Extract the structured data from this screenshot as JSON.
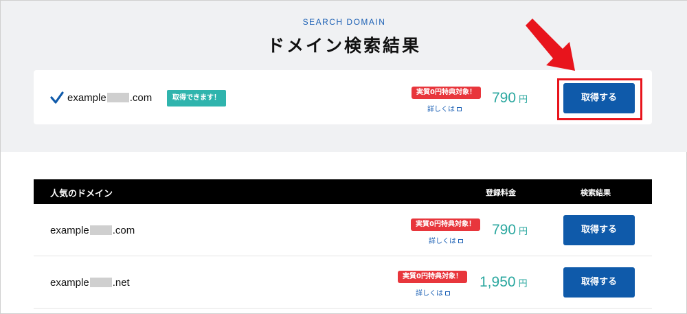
{
  "header": {
    "subtitle": "SEARCH DOMAIN",
    "title": "ドメイン検索結果"
  },
  "search_result": {
    "check_icon": "check-icon",
    "domain_prefix": "example",
    "domain_suffix": ".com",
    "available_badge": "取得できます！",
    "campaign_tag": "実質0円特典対象！",
    "detail_link": "詳しくは",
    "price": "790",
    "currency": "円",
    "button_label": "取得する"
  },
  "table": {
    "headers": {
      "popular": "人気のドメイン",
      "fee": "登録料金",
      "result": "検索結果"
    },
    "rows": [
      {
        "domain_prefix": "example",
        "domain_suffix": ".com",
        "campaign_tag": "実質0円特典対象！",
        "detail_link": "詳しくは",
        "price": "790",
        "currency": "円",
        "button_label": "取得する"
      },
      {
        "domain_prefix": "example",
        "domain_suffix": ".net",
        "campaign_tag": "実質0円特典対象！",
        "detail_link": "詳しくは",
        "price": "1,950",
        "currency": "円",
        "button_label": "取得する"
      }
    ]
  },
  "colors": {
    "accent_blue": "#0f5aaa",
    "price_teal": "#2aa79f",
    "campaign_red": "#e8363c",
    "annotation_red": "#e8141c"
  }
}
